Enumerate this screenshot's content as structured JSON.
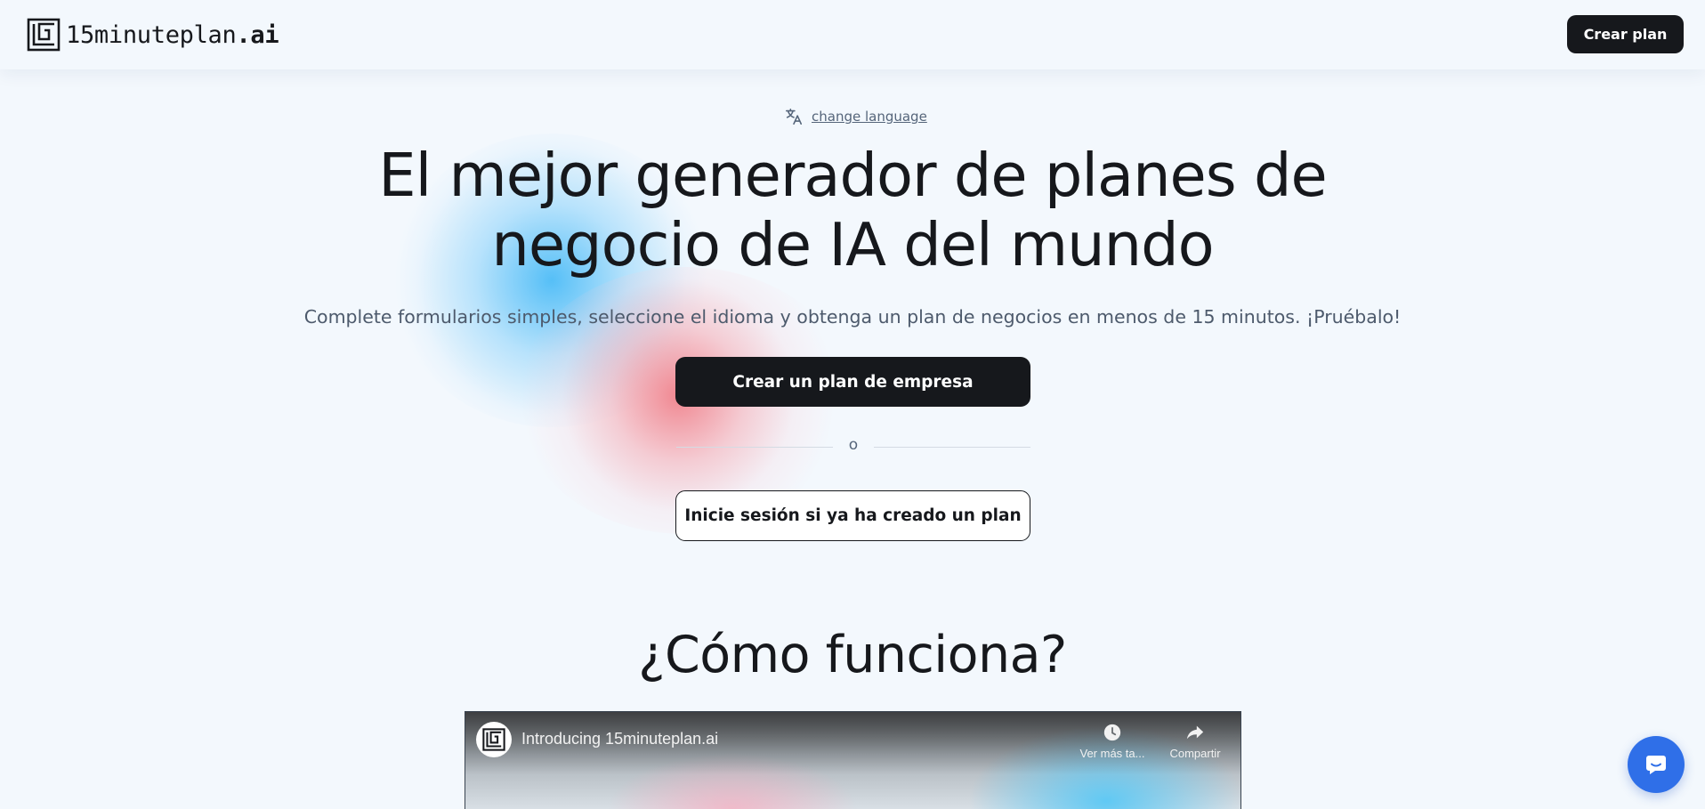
{
  "header": {
    "brand_name": "15minuteplan",
    "brand_tld": ".ai",
    "cta_label": "Crear plan"
  },
  "hero": {
    "language_link": "change language",
    "title_line1": "El mejor generador de planes de",
    "title_line2": "negocio de IA del mundo",
    "subtitle": "Complete formularios simples, seleccione el idioma y obtenga un plan de negocios en menos de 15 minutos. ¡Pruébalo!",
    "primary_button": "Crear un plan de empresa",
    "divider_text": "o",
    "secondary_button": "Inicie sesión si ya ha creado un plan"
  },
  "how_it_works": {
    "title": "¿Cómo funciona?"
  },
  "video": {
    "title": "Introducing 15minuteplan.ai",
    "watch_later_label": "Ver más ta...",
    "share_label": "Compartir"
  },
  "icons": {
    "brand_logo": "brand-logo-icon",
    "language": "translate-icon",
    "watch_later": "clock-icon",
    "share": "share-arrow-icon",
    "chat": "chat-bubble-icon"
  },
  "colors": {
    "background": "#f3f8fd",
    "primary_dark": "#16181c",
    "chat_blue": "#2f6fe8",
    "glow_blue": "#3ab5f6",
    "glow_red": "#f07882"
  }
}
